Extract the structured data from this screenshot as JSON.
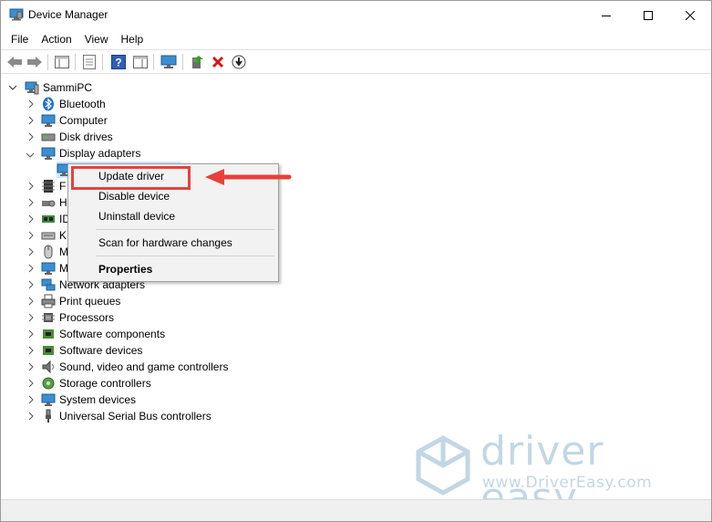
{
  "window": {
    "title": "Device Manager",
    "controls": {
      "minimize": "minimize",
      "maximize": "maximize",
      "close": "close"
    }
  },
  "menubar": [
    "File",
    "Action",
    "View",
    "Help"
  ],
  "toolbar": {
    "buttons": [
      "back-icon",
      "forward-icon",
      "show-hide-console-tree-icon",
      "properties-icon",
      "help-icon",
      "action-pane-icon",
      "monitor-icon",
      "update-driver-icon",
      "uninstall-icon",
      "download-icon"
    ]
  },
  "tree": {
    "root": {
      "label": "SammiPC",
      "icon": "computer-icon"
    },
    "nodes": [
      {
        "label": "Bluetooth",
        "icon": "bluetooth-icon"
      },
      {
        "label": "Computer",
        "icon": "computer-icon"
      },
      {
        "label": "Disk drives",
        "icon": "disk-icon"
      },
      {
        "label": "Display adapters",
        "icon": "display-icon"
      },
      {
        "label": "",
        "icon": "display-icon"
      },
      {
        "label": "F",
        "icon": "firmware-icon"
      },
      {
        "label": "H",
        "icon": "hid-icon"
      },
      {
        "label": "ID",
        "icon": "ide-icon"
      },
      {
        "label": "K",
        "icon": "keyboard-icon"
      },
      {
        "label": "M",
        "icon": "mouse-icon"
      },
      {
        "label": "M",
        "icon": "monitor-icon"
      },
      {
        "label": "Network adapters",
        "icon": "network-icon"
      },
      {
        "label": "Print queues",
        "icon": "printer-icon"
      },
      {
        "label": "Processors",
        "icon": "processor-icon"
      },
      {
        "label": "Software components",
        "icon": "component-icon"
      },
      {
        "label": "Software devices",
        "icon": "component-icon"
      },
      {
        "label": "Sound, video and game controllers",
        "icon": "sound-icon"
      },
      {
        "label": "Storage controllers",
        "icon": "storage-icon"
      },
      {
        "label": "System devices",
        "icon": "system-icon"
      },
      {
        "label": "Universal Serial Bus controllers",
        "icon": "usb-icon"
      }
    ]
  },
  "context_menu": {
    "update_driver": "Update driver",
    "disable_device": "Disable device",
    "uninstall_device": "Uninstall device",
    "scan": "Scan for hardware changes",
    "properties": "Properties"
  },
  "annotation": {
    "highlight_color": "#e8413c"
  },
  "watermark": {
    "name": "driver easy",
    "url": "www.DriverEasy.com"
  }
}
